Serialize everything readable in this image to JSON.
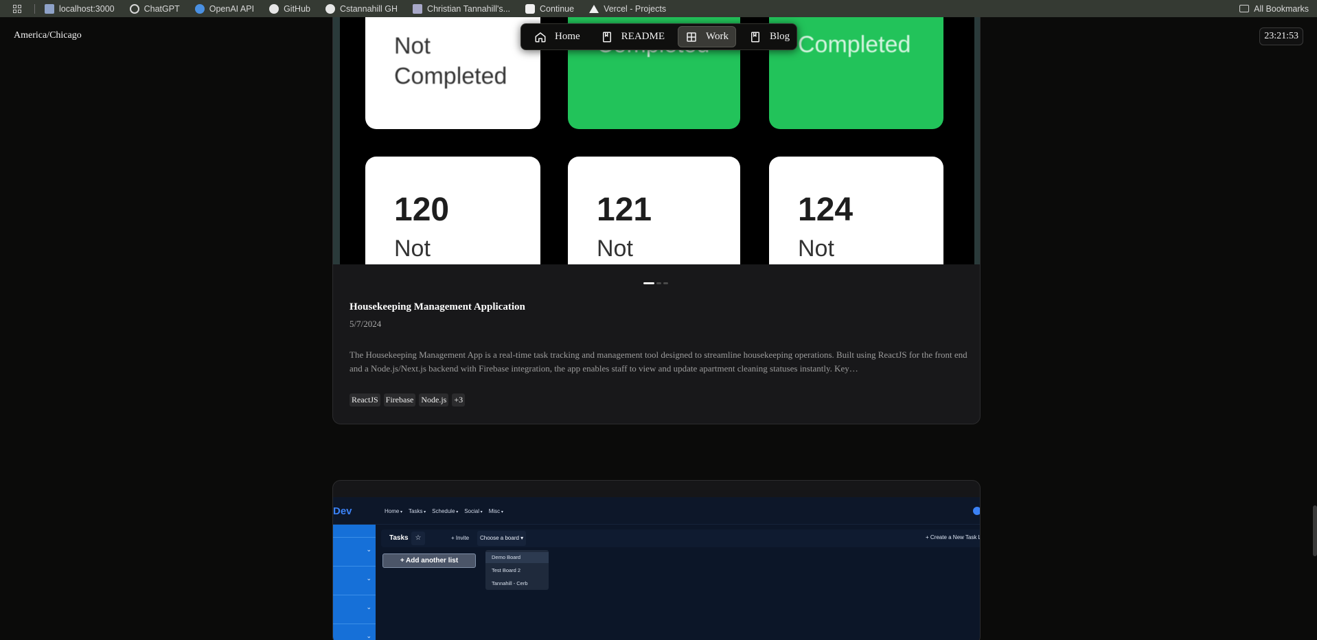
{
  "bookmarks": {
    "items": [
      {
        "label": "localhost:3000",
        "icon": "localhost-icon"
      },
      {
        "label": "ChatGPT",
        "icon": "chatgpt-icon"
      },
      {
        "label": "OpenAI API",
        "icon": "openai-icon"
      },
      {
        "label": "GitHub",
        "icon": "github-icon"
      },
      {
        "label": "Cstannahill GH",
        "icon": "github-icon"
      },
      {
        "label": "Christian Tannahill's...",
        "icon": "page-icon"
      },
      {
        "label": "Continue",
        "icon": "continue-icon"
      },
      {
        "label": "Vercel - Projects",
        "icon": "vercel-icon"
      }
    ],
    "all_label": "All Bookmarks"
  },
  "header": {
    "timezone": "America/Chicago",
    "clock": "23:21:53"
  },
  "nav": {
    "items": [
      {
        "label": "Home",
        "icon": "home-icon"
      },
      {
        "label": "README",
        "icon": "book-icon"
      },
      {
        "label": "Work",
        "icon": "grid-icon",
        "active": true
      },
      {
        "label": "Blog",
        "icon": "book-icon"
      }
    ]
  },
  "project1": {
    "screenshot": {
      "top_row": [
        "Not Completed",
        "Completed",
        "Completed"
      ],
      "bottom_row": [
        {
          "number": "120",
          "status": "Not"
        },
        {
          "number": "121",
          "status": "Not"
        },
        {
          "number": "124",
          "status": "Not"
        }
      ]
    },
    "carousel_index": 1,
    "carousel_total": 3,
    "title": "Housekeeping Management Application",
    "date": "5/7/2024",
    "description": "The Housekeeping Management App is a real-time task tracking and management tool designed to streamline housekeeping operations. Built using ReactJS for the front end and a Node.js/Next.js backend with Firebase integration, the app enables staff to view and update apartment cleaning statuses instantly. Key…",
    "tags": [
      "ReactJS",
      "Firebase",
      "Node.js",
      "+3"
    ]
  },
  "project2": {
    "screenshot": {
      "logo": "Dev",
      "menu": [
        "Home",
        "Tasks",
        "Schedule",
        "Social",
        "Misc"
      ],
      "toolbar": {
        "tasks": "Tasks",
        "invite": "+ Invite",
        "choose_board": "Choose a board ▾",
        "create": "+ Create a New Task L"
      },
      "add_list": "+ Add another list",
      "dropdown": [
        "Demo Board",
        "Test Board 2",
        "Tannahill - Cerb"
      ]
    }
  },
  "colors": {
    "green": "#22c35a",
    "accent_blue": "#1670d8"
  }
}
